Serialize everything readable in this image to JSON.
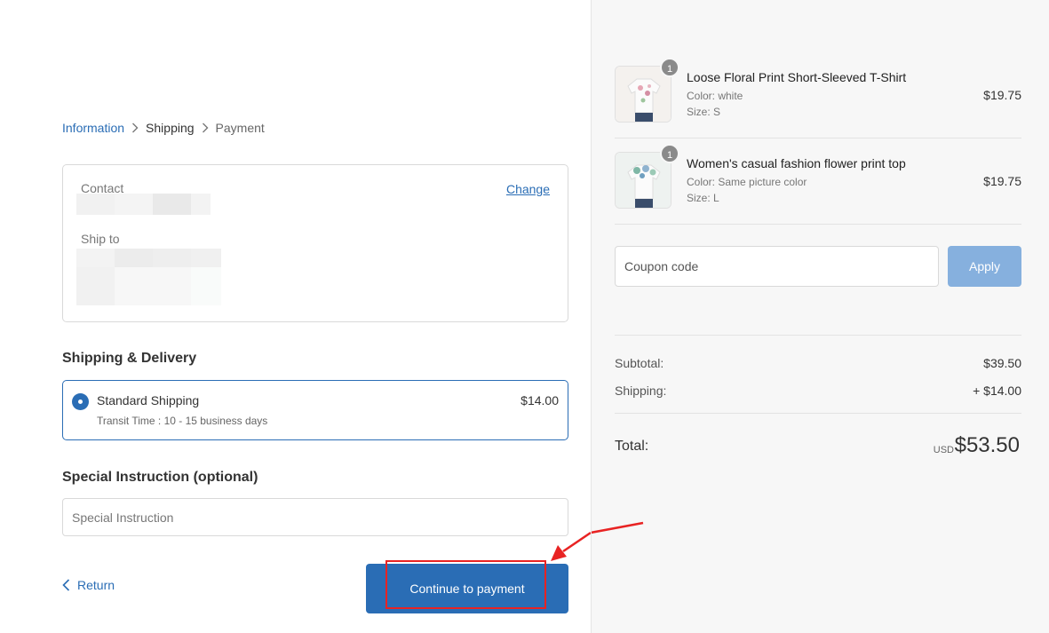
{
  "breadcrumb": {
    "information": "Information",
    "shipping": "Shipping",
    "payment": "Payment"
  },
  "info": {
    "contact_label": "Contact",
    "change_label": "Change",
    "ship_to_label": "Ship to"
  },
  "shipping": {
    "section_title": "Shipping & Delivery",
    "method_name": "Standard Shipping",
    "transit": "Transit Time : 10 - 15 business days",
    "price": "$14.00"
  },
  "instruction": {
    "section_title": "Special Instruction (optional)",
    "placeholder": "Special Instruction"
  },
  "actions": {
    "return_label": "Return",
    "continue_label": "Continue to payment"
  },
  "cart": {
    "items": [
      {
        "qty": "1",
        "name": "Loose Floral Print Short-Sleeved T-Shirt",
        "color": "Color:  white",
        "size": "Size:  S",
        "price": "$19.75"
      },
      {
        "qty": "1",
        "name": "Women's casual fashion flower print top",
        "color": "Color:  Same picture color",
        "size": "Size:  L",
        "price": "$19.75"
      }
    ],
    "coupon_placeholder": "Coupon code",
    "apply_label": "Apply"
  },
  "summary": {
    "subtotal_label": "Subtotal:",
    "subtotal_value": "$39.50",
    "shipping_label": "Shipping:",
    "shipping_value": "+ $14.00",
    "total_label": "Total:",
    "currency": "USD",
    "total_value": "$53.50"
  },
  "colors": {
    "accent": "#2a6db5",
    "apply_button": "#86b0de",
    "annotation_red": "#e82323",
    "right_panel_bg": "#f7f7f7"
  }
}
